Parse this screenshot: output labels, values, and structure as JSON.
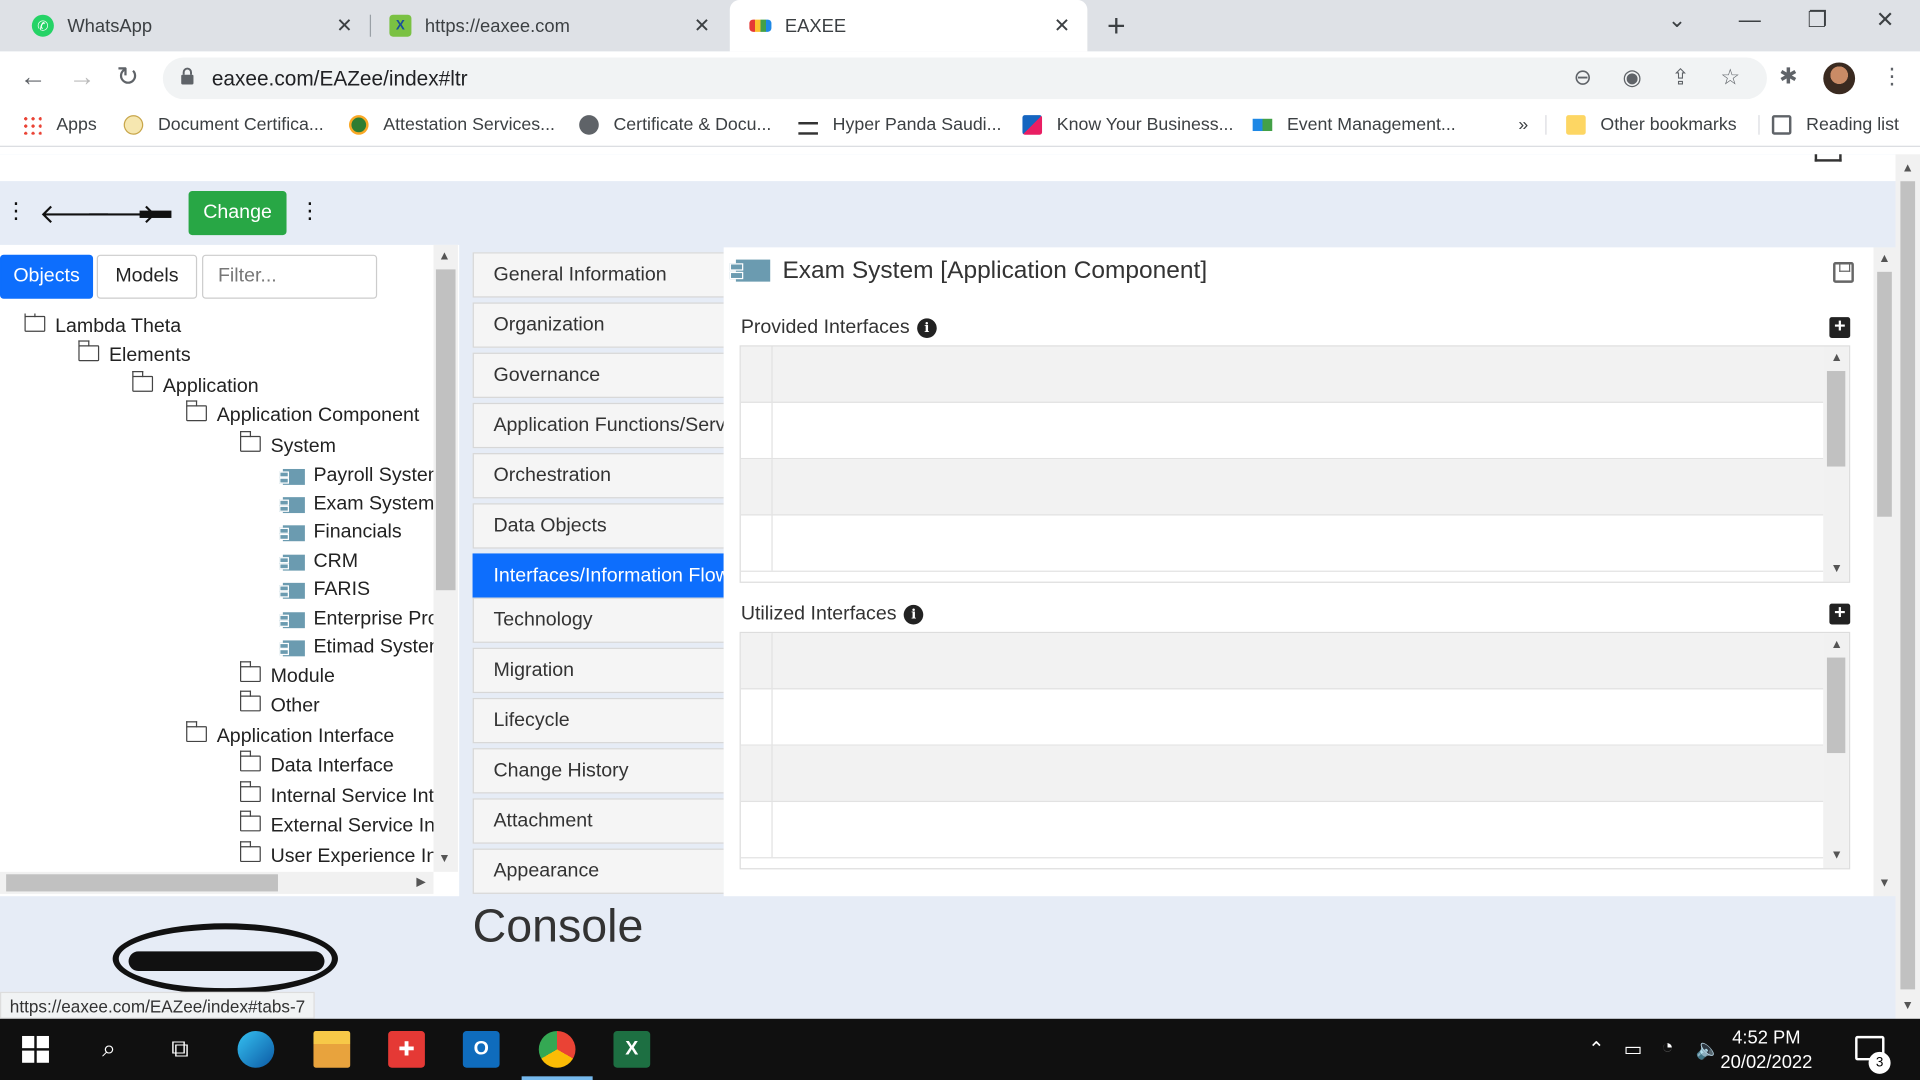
{
  "browser": {
    "tabs": [
      {
        "title": "WhatsApp",
        "icon": "whatsapp-icon",
        "active": false
      },
      {
        "title": "https://eaxee.com",
        "icon": "eaxee-icon",
        "active": false
      },
      {
        "title": "EAXEE",
        "icon": "eaxee-chart-icon",
        "active": true
      }
    ],
    "new_tab": "+",
    "url": "eaxee.com/EAZee/index#ltr",
    "bookmarks": [
      {
        "label": "Apps",
        "icon": "apps-grid-icon"
      },
      {
        "label": "Document Certifica...",
        "icon": "bookmark-icon"
      },
      {
        "label": "Attestation Services...",
        "icon": "bookmark-icon"
      },
      {
        "label": "Certificate & Docu...",
        "icon": "globe-icon"
      },
      {
        "label": "Hyper Panda Saudi...",
        "icon": "cart-icon"
      },
      {
        "label": "Know Your Business...",
        "icon": "bookmark-icon"
      },
      {
        "label": "Event Management...",
        "icon": "bookmark-icon"
      }
    ],
    "bookmarks_overflow": "»",
    "other_bookmarks": "Other bookmarks",
    "reading_list": "Reading list"
  },
  "app": {
    "change_button": "Change",
    "left_tabs": {
      "objects": "Objects",
      "models": "Models"
    },
    "filter_placeholder": "Filter...",
    "tree": [
      {
        "label": "Lambda Theta",
        "type": "folder",
        "level": 0
      },
      {
        "label": "Elements",
        "type": "folder",
        "level": 1
      },
      {
        "label": "Application",
        "type": "folder",
        "level": 2
      },
      {
        "label": "Application Component",
        "type": "folder",
        "level": 3
      },
      {
        "label": "System",
        "type": "folder",
        "level": 4
      },
      {
        "label": "Payroll System",
        "type": "component",
        "level": 5
      },
      {
        "label": "Exam System",
        "type": "component",
        "level": 5
      },
      {
        "label": "Financials",
        "type": "component",
        "level": 5
      },
      {
        "label": "CRM",
        "type": "component",
        "level": 5
      },
      {
        "label": "FARIS",
        "type": "component",
        "level": 5
      },
      {
        "label": "Enterprise Pro",
        "type": "component",
        "level": 5
      },
      {
        "label": "Etimad System",
        "type": "component",
        "level": 5
      },
      {
        "label": "Module",
        "type": "folder",
        "level": 4
      },
      {
        "label": "Other",
        "type": "folder",
        "level": 4
      },
      {
        "label": "Application Interface",
        "type": "folder",
        "level": 3
      },
      {
        "label": "Data Interface",
        "type": "folder",
        "level": 4
      },
      {
        "label": "Internal Service Inte",
        "type": "folder",
        "level": 4
      },
      {
        "label": "External Service Int",
        "type": "folder",
        "level": 4
      },
      {
        "label": "User Experience Int",
        "type": "folder",
        "level": 4
      }
    ],
    "middle_tabs": [
      {
        "label": "General Information",
        "selected": false
      },
      {
        "label": "Organization",
        "selected": false
      },
      {
        "label": "Governance",
        "selected": false
      },
      {
        "label": "Application Functions/Servi",
        "selected": false
      },
      {
        "label": "Orchestration",
        "selected": false
      },
      {
        "label": "Data Objects",
        "selected": false
      },
      {
        "label": "Interfaces/Information Flow",
        "selected": true
      },
      {
        "label": "Technology",
        "selected": false
      },
      {
        "label": "Migration",
        "selected": false
      },
      {
        "label": "Lifecycle",
        "selected": false
      },
      {
        "label": "Change History",
        "selected": false
      },
      {
        "label": "Attachment",
        "selected": false
      },
      {
        "label": "Appearance",
        "selected": false
      }
    ],
    "content": {
      "title": "Exam System [Application Component]",
      "provided_label": "Provided Interfaces",
      "utilized_label": "Utilized Interfaces",
      "info_glyph": "i",
      "add_glyph": "+"
    },
    "console_title": "Console",
    "status_url": "https://eaxee.com/EAZee/index#tabs-7"
  },
  "taskbar": {
    "time": "4:52 PM",
    "date": "20/02/2022",
    "notifications": "3"
  },
  "colors": {
    "accent": "#0d6efd",
    "change_button": "#28a745",
    "component_icon": "#6b9bb0"
  }
}
